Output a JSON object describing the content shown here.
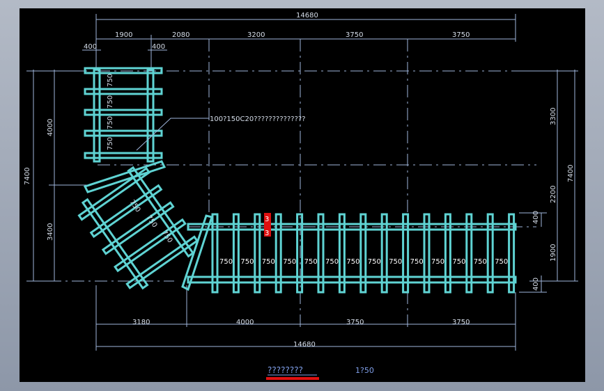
{
  "colors": {
    "background": "#000000",
    "beam": "#5fd3d3",
    "dimension": "#9fb6dc",
    "marker": "#e01010"
  },
  "top": {
    "overall": "14680",
    "segments": [
      "1900",
      "2080",
      "3200",
      "3750",
      "3750"
    ],
    "small_left": "400",
    "small_right": "400"
  },
  "bottom": {
    "overall": "14680",
    "segments": [
      "3180",
      "4000",
      "3750",
      "3750"
    ]
  },
  "left": {
    "overall": "7400",
    "upper": "4000",
    "lower": "3400"
  },
  "right": {
    "overall": "7400",
    "upper": "3300",
    "middle": "2200",
    "lower": "1900",
    "small_top": "400",
    "small_bottom": "400"
  },
  "spacing_label": "750",
  "callout": "100?150C20??????????????",
  "marker_text": "3",
  "title": {
    "text": "????????",
    "scale": "1?50"
  }
}
